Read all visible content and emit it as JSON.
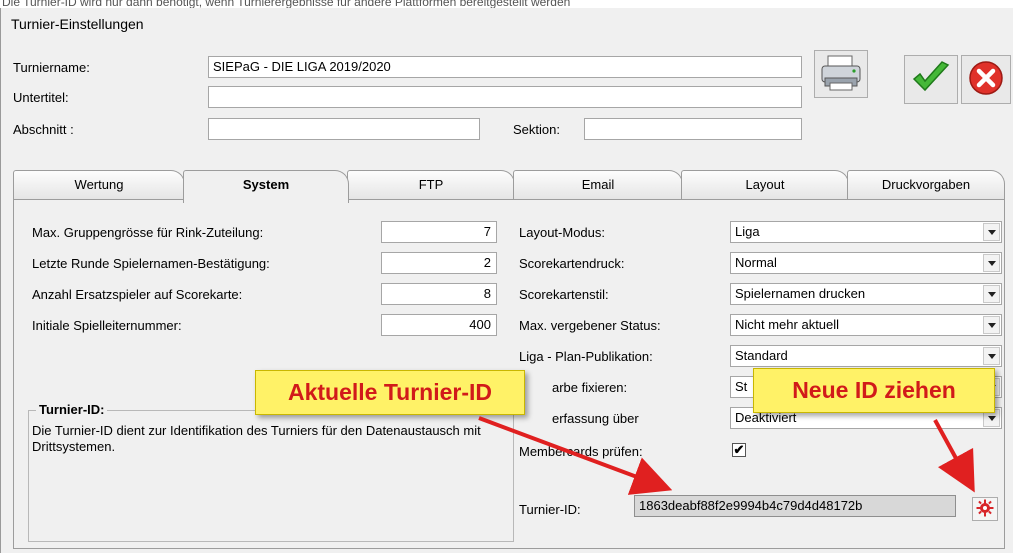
{
  "cut_text": "Die Turnier-ID wird nur dann benötigt, wenn Turnierergebnisse für andere Plattformen bereitgestellt werden",
  "window": {
    "title": "Turnier-Einstellungen"
  },
  "header": {
    "turniername_label": "Turniername:",
    "turniername_value": "SIEPaG - DIE LIGA 2019/2020",
    "untertitel_label": "Untertitel:",
    "untertitel_value": "",
    "abschnitt_label": "Abschnitt :",
    "abschnitt_value": "",
    "sektion_label": "Sektion:",
    "sektion_value": ""
  },
  "toolbar": {
    "print_icon": "printer-icon",
    "ok_icon": "checkmark-icon",
    "cancel_icon": "red-x-icon"
  },
  "tabs": [
    {
      "label": "Wertung",
      "active": false
    },
    {
      "label": "System",
      "active": true
    },
    {
      "label": "FTP",
      "active": false
    },
    {
      "label": "Email",
      "active": false
    },
    {
      "label": "Layout",
      "active": false
    },
    {
      "label": "Druckvorgaben",
      "active": false
    }
  ],
  "left_settings": [
    {
      "label": "Max. Gruppengrösse für Rink-Zuteilung:",
      "value": "7"
    },
    {
      "label": "Letzte Runde Spielernamen-Bestätigung:",
      "value": "2"
    },
    {
      "label": "Anzahl Ersatzspieler auf Scorekarte:",
      "value": "8"
    },
    {
      "label": "Initiale Spielleiternummer:",
      "value": "400"
    }
  ],
  "right_settings": [
    {
      "label": "Layout-Modus:",
      "value": "Liga"
    },
    {
      "label": "Scorekartendruck:",
      "value": "Normal"
    },
    {
      "label": "Scorekartenstil:",
      "value": "Spielernamen drucken"
    },
    {
      "label": "Max. vergebener Status:",
      "value": "Nicht mehr aktuell"
    },
    {
      "label": "Liga - Plan-Publikation:",
      "value": "Standard"
    },
    {
      "label": "arbe fixieren:",
      "value": "St"
    },
    {
      "label": "erfassung über",
      "value": "Deaktiviert"
    }
  ],
  "membercards": {
    "label": "Membercards prüfen:",
    "checked": "✔"
  },
  "turnier_id": {
    "label": "Turnier-ID:",
    "value": "1863deabf88f2e9994b4c79d4d48172b",
    "group_title": "Turnier-ID:",
    "description": "Die Turnier-ID dient zur Identifikation des Turniers für den Datenaustausch mit Drittsystemen."
  },
  "callouts": {
    "current": "Aktuelle Turnier-ID",
    "new": "Neue ID ziehen"
  },
  "colors": {
    "callout_bg": "#fff267",
    "callout_text": "#d11a1a",
    "arrow": "#e02020"
  }
}
